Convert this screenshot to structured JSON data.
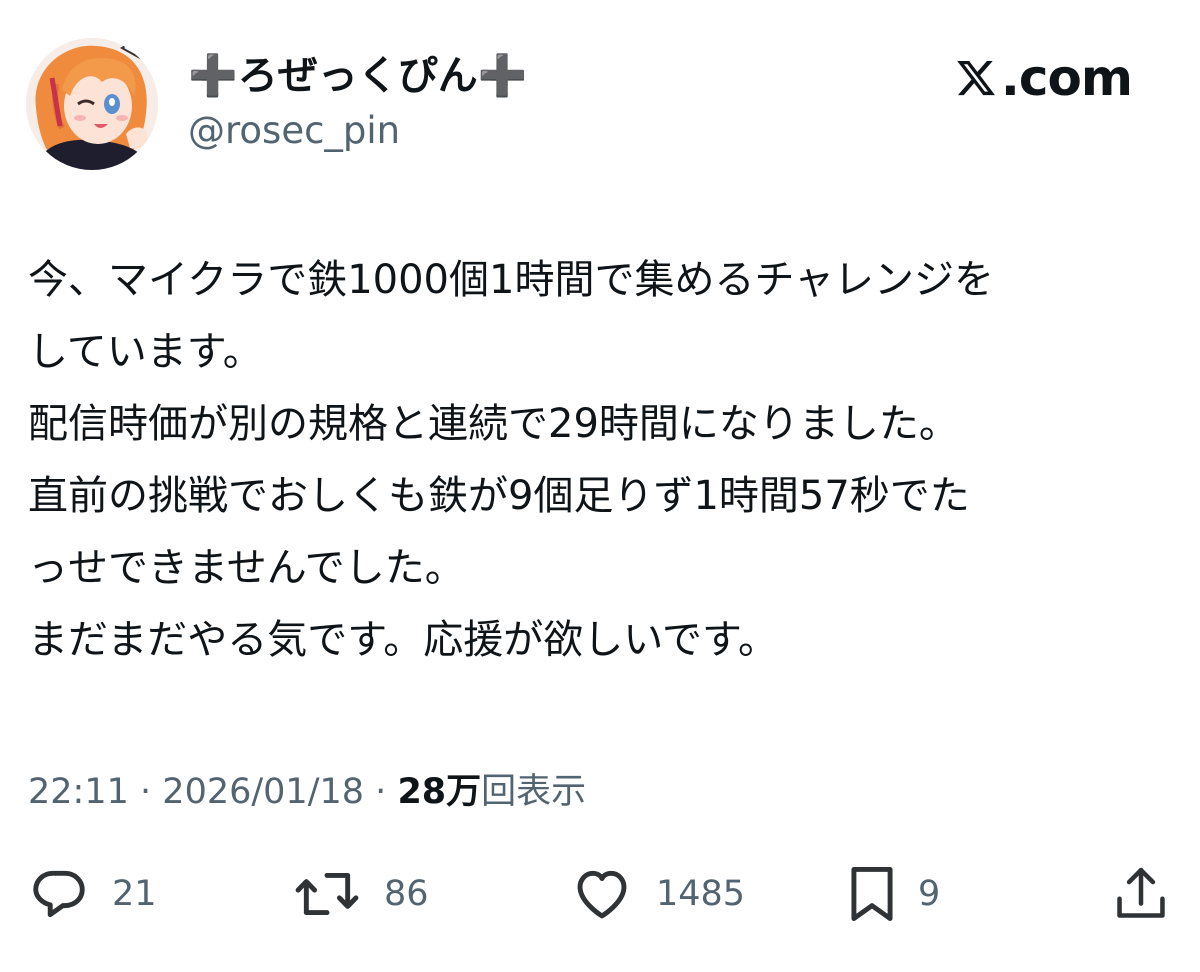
{
  "author": {
    "display_name": "➕ろぜっくぴん➕",
    "handle": "@rosec_pin"
  },
  "brand": {
    "label": ".com",
    "icon": "x-logo-icon"
  },
  "tweet": {
    "lines": [
      "今、マイクラで鉄1000個1時間で集めるチャレンジを",
      "しています。",
      "配信時価が別の規格と連続で29時間になりました。",
      "直前の挑戦でおしくも鉄が9個足りず1時間57秒でた",
      "っせできませんでした。",
      "まだまだやる気です。応援が欲しいです。"
    ]
  },
  "meta": {
    "time": "22:11",
    "separator": "·",
    "date": "2026/01/18",
    "views_count": "28万",
    "views_label": "回表示"
  },
  "actions": {
    "replies": "21",
    "reposts": "86",
    "likes": "1485",
    "bookmarks": "9"
  },
  "icons": {
    "reply": "reply-icon",
    "repost": "repost-icon",
    "like": "heart-icon",
    "bookmark": "bookmark-icon",
    "share": "share-icon"
  },
  "colors": {
    "text": "#0f1419",
    "secondary": "#536471",
    "background": "#ffffff"
  }
}
